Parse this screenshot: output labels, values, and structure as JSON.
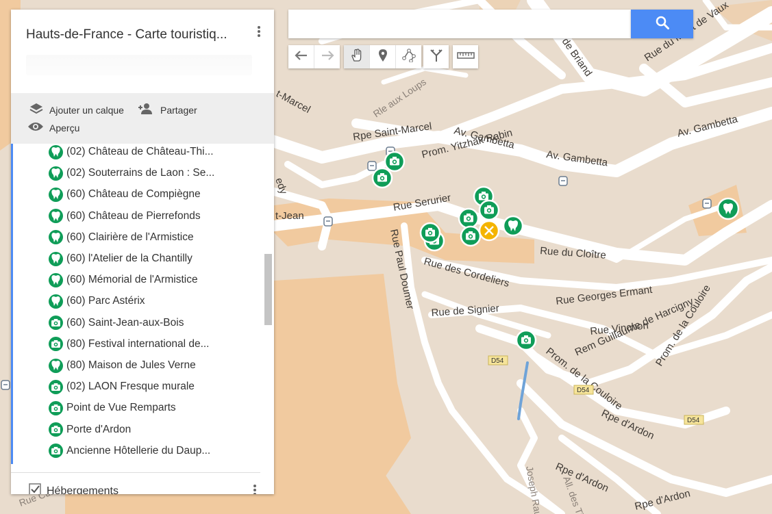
{
  "map_panel": {
    "title": "Hauts-de-France - Carte touristiq...",
    "actions": {
      "add_layer": "Ajouter un calque",
      "share": "Partager",
      "preview": "Aperçu"
    },
    "items": [
      {
        "label": "(02) Château de Château-Thi...",
        "icon": "attraction-icon"
      },
      {
        "label": "(02) Souterrains de Laon : Se...",
        "icon": "attraction-icon"
      },
      {
        "label": "(60) Château de Compiègne",
        "icon": "attraction-icon"
      },
      {
        "label": "(60) Château de Pierrefonds",
        "icon": "attraction-icon"
      },
      {
        "label": "(60) Clairière de l'Armistice",
        "icon": "attraction-icon"
      },
      {
        "label": "(60) l'Atelier de la Chantilly",
        "icon": "attraction-icon"
      },
      {
        "label": "(60) Mémorial de l'Armistice",
        "icon": "attraction-icon"
      },
      {
        "label": "(60) Parc Astérix",
        "icon": "attraction-icon"
      },
      {
        "label": "(60) Saint-Jean-aux-Bois",
        "icon": "camera-icon"
      },
      {
        "label": "(80) Festival international de...",
        "icon": "camera-icon"
      },
      {
        "label": "(80) Maison de Jules Verne",
        "icon": "attraction-icon"
      },
      {
        "label": "(02) LAON Fresque murale",
        "icon": "camera-icon"
      },
      {
        "label": "Point de Vue Remparts",
        "icon": "camera-icon"
      },
      {
        "label": "Porte d'Ardon",
        "icon": "camera-icon"
      },
      {
        "label": "Ancienne Hôtellerie du Daup...",
        "icon": "camera-icon"
      }
    ],
    "layer": {
      "label": "Hébergements",
      "checked": true
    }
  },
  "search": {
    "value": "",
    "placeholder": ""
  },
  "toolbar": {
    "history": [
      "undo-icon",
      "redo-icon"
    ],
    "tools": [
      "hand-icon",
      "marker-icon",
      "line-icon"
    ],
    "directions": "directions-icon",
    "measure": "ruler-icon"
  },
  "map": {
    "streets": {
      "rpe_saint_marcel": "Rpe Saint-Marcel",
      "av_gambetta_1": "Av. Gambetta",
      "av_gambetta_2": "Av. Gambetta",
      "av_gambetta_3": "Av. Gambetta",
      "prom_yitzhak_rabin": "Prom. Yitzhak Rabin",
      "rue_serurier": "Rue Serurier",
      "rue_du_cloitre": "Rue du Cloître",
      "rue_paul_doumer": "Rue Paul Doumer",
      "rue_des_cordeliers": "Rue des Cordeliers",
      "rue_georges_ermant": "Rue Georges Ermant",
      "rue_de_signier": "Rue de Signier",
      "rue_vinchon": "Rue Vinchon",
      "rem_guillaume": "Rem Guillaume de Harcigny",
      "prom_couloire_1": "Prom. de la Couloire",
      "prom_couloire_2": "Prom. de la Couloire",
      "rpe_ardon_1": "Rpe d'Ardon",
      "rpe_ardon_2": "Rpe d'Ardon",
      "rpe_ardon_3": "Rpe d'Ardon",
      "rue_mont_vaux": "Rue du Mont de Vaux",
      "de_briand": "de Briand",
      "rle_aux_loups": "Rle aux Loups",
      "st_marcel": "t-Marcel",
      "st_jean": "t-Jean",
      "joseph_raux": "Joseph Raux",
      "all_tilleuls": "All. des Tilleuls",
      "rue_curie": "Rue Curie",
      "edy": "edy"
    },
    "road_badges": [
      "D54",
      "D54",
      "D54"
    ],
    "colors": {
      "marker_green": "#0f9d58",
      "marker_yellow": "#f4b400",
      "land": "#e9dccd",
      "park": "#f2c797",
      "road": "#ffffff",
      "water": "#6fa3d8",
      "accent_blue": "#4c8bf5"
    }
  }
}
